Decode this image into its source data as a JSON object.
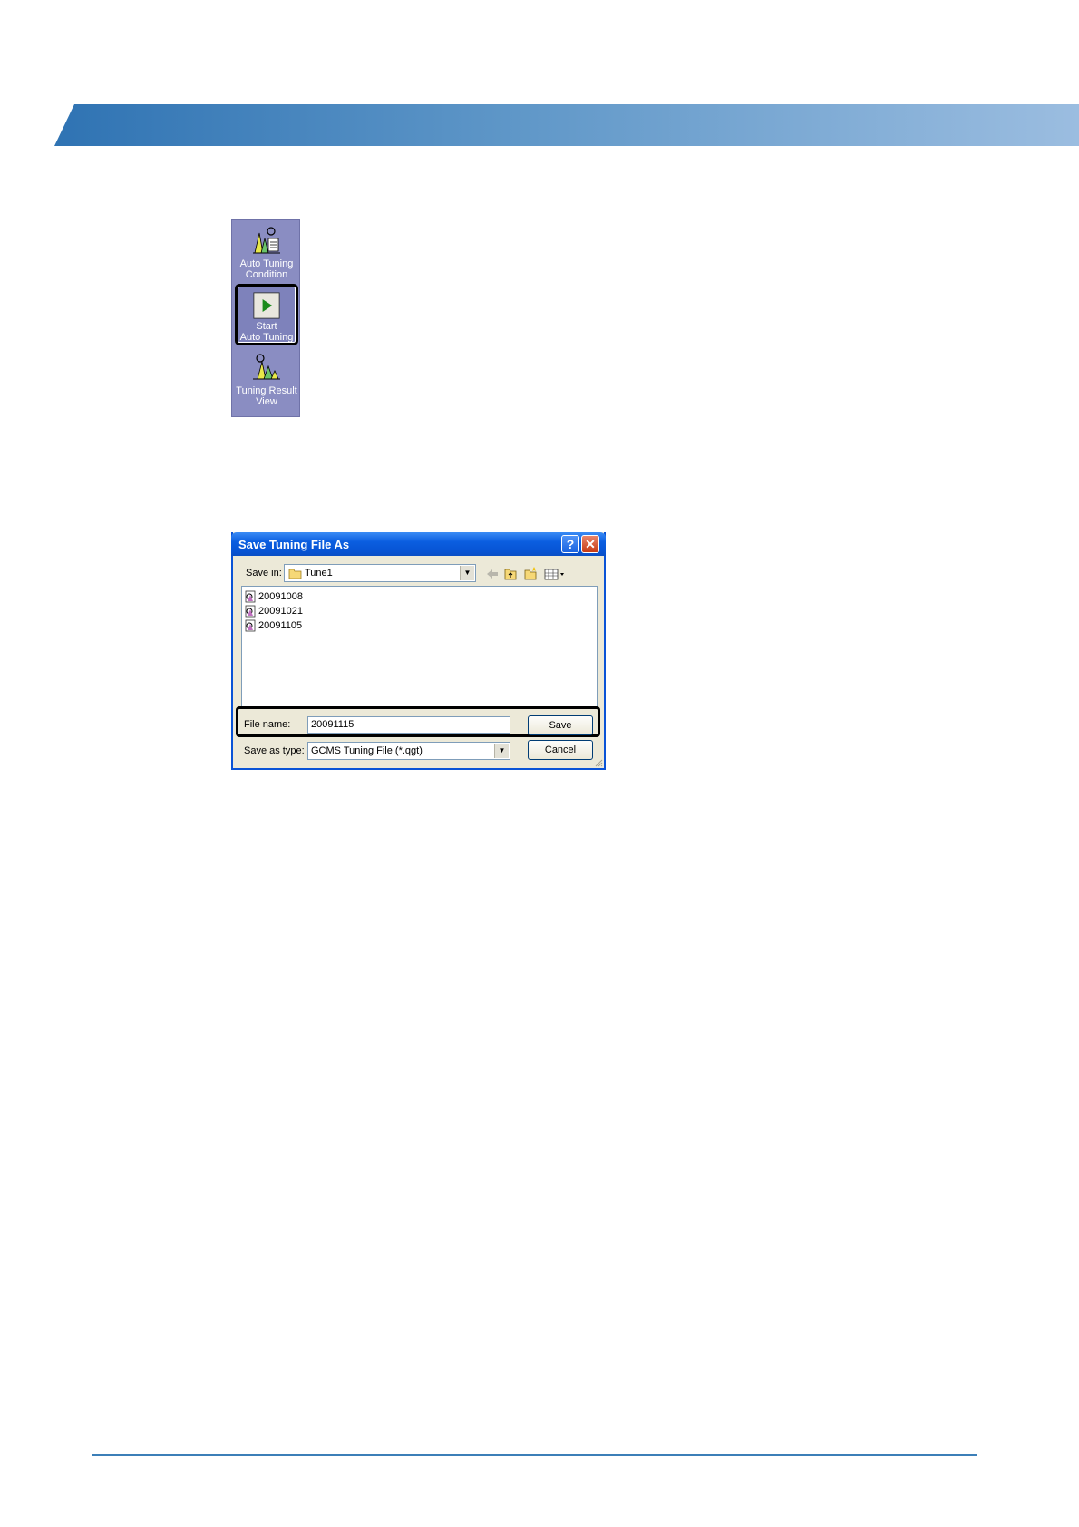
{
  "toolbar": {
    "items": [
      {
        "label_line1": "Auto Tuning",
        "label_line2": "Condition",
        "icon": "auto-tuning-condition-icon"
      },
      {
        "label_line1": "Start",
        "label_line2": "Auto Tuning",
        "icon": "play-icon",
        "selected": true
      },
      {
        "label_line1": "Tuning Result",
        "label_line2": "View",
        "icon": "tuning-result-icon"
      }
    ]
  },
  "dialog": {
    "title": "Save Tuning File As",
    "save_in_label": "Save in:",
    "save_in_value": "Tune1",
    "files": [
      "20091008",
      "20091021",
      "20091105"
    ],
    "file_name_label": "File name:",
    "file_name_value": "20091115",
    "save_as_type_label": "Save as type:",
    "save_as_type_value": "GCMS Tuning File (*.qgt)",
    "save_button": "Save",
    "cancel_button": "Cancel"
  },
  "colors": {
    "header_band": "#2f73b3",
    "panel": "#8a8dc2",
    "titlebar": "#0754d4"
  }
}
